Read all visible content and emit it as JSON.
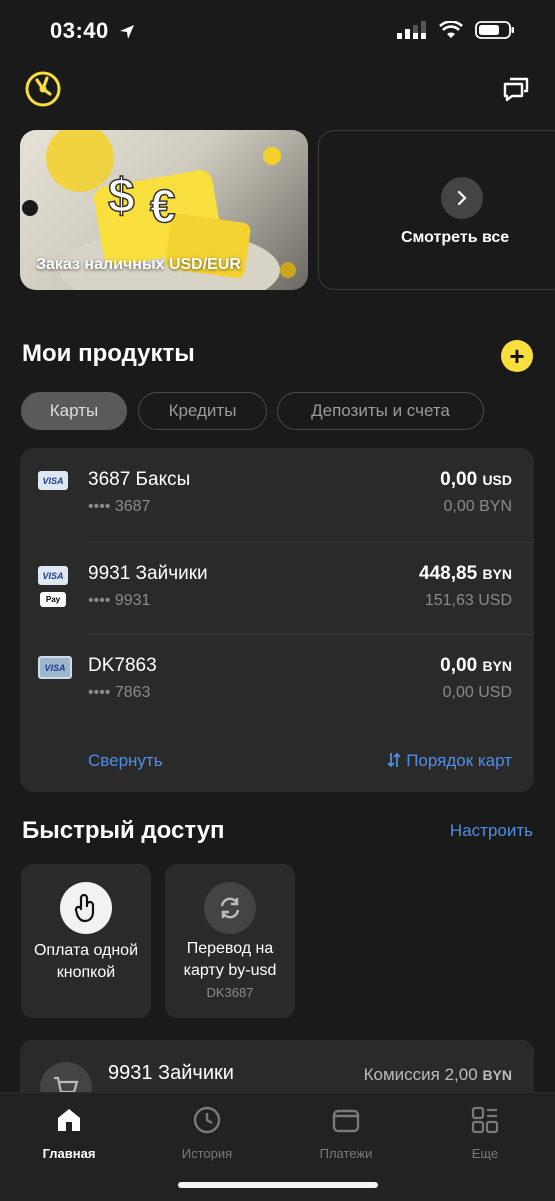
{
  "status": {
    "time": "03:40"
  },
  "promo": {
    "title": "Заказ наличных USD/EUR",
    "see_all": "Смотреть все"
  },
  "products": {
    "title": "Мои продукты",
    "tabs": [
      "Карты",
      "Кредиты",
      "Депозиты и счета"
    ],
    "cards": [
      {
        "name": "3687 Баксы",
        "mask": "•••• 3687",
        "amount": "0,00",
        "currency": "USD",
        "secondary": "0,00 BYN",
        "apple_pay": false
      },
      {
        "name": "9931 Зайчики",
        "mask": "•••• 9931",
        "amount": "448,85",
        "currency": "BYN",
        "secondary": "151,63 USD",
        "apple_pay": true
      },
      {
        "name": "DK7863",
        "mask": "•••• 7863",
        "amount": "0,00",
        "currency": "BYN",
        "secondary": "0,00 USD",
        "apple_pay": false
      }
    ],
    "collapse": "Свернуть",
    "card_order": "Порядок карт"
  },
  "quick_access": {
    "title": "Быстрый доступ",
    "configure": "Настроить",
    "tiles": [
      {
        "label": "Оплата одной кнопкой",
        "sub": ""
      },
      {
        "label": "Перевод на карту by-usd",
        "sub": "DK3687"
      }
    ]
  },
  "payment": {
    "name": "9931 Зайчики",
    "commission": "Комиссия 2,00",
    "currency": "BYN"
  },
  "nav": {
    "items": [
      "Главная",
      "История",
      "Платежи",
      "Еще"
    ]
  },
  "brand": {
    "accent": "#f8df3d",
    "link": "#4d8fe6"
  },
  "card_labels": {
    "visa": "VISA",
    "apple_pay": "Pay"
  }
}
